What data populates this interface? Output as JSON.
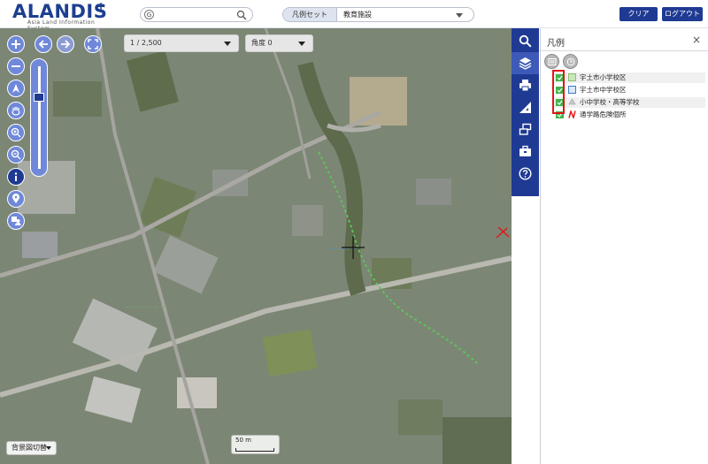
{
  "app": {
    "logo_title": "ALANDIS",
    "logo_plus": "+",
    "logo_subtitle": "Asia Land Information System"
  },
  "header": {
    "search": {
      "prefix": "G",
      "value": ""
    },
    "legend_set": {
      "label": "凡例セット",
      "value": "教育施設"
    },
    "clear_label": "クリア",
    "logout_label": "ログアウト"
  },
  "map": {
    "scale_select": "1 / 2,500",
    "angle_select": "角度 0",
    "basemap_button": "背景図切替",
    "scalebar_label": "50 m"
  },
  "toolbar": {
    "tools": [
      "search-icon",
      "layers-icon",
      "print-icon",
      "measure-icon",
      "window-icon",
      "toolbox-icon",
      "help-icon"
    ]
  },
  "legend_panel": {
    "title": "凡例",
    "close": "×",
    "layers": [
      {
        "label": "宇土市小学校区",
        "checked": true,
        "swatch": "#9ccf88",
        "icon": "green-square-icon"
      },
      {
        "label": "宇土市中学校区",
        "checked": true,
        "swatch": "#6aa6e0",
        "icon": "blue-square-icon"
      },
      {
        "label": "小中学校・高等学校",
        "checked": true,
        "swatch": "#b9b9b9",
        "icon": "school-icon"
      },
      {
        "label": "通学路危険個所",
        "checked": true,
        "swatch": "#e01818",
        "icon": "red-n-icon"
      }
    ]
  },
  "colors": {
    "primary": "#1f3a93",
    "control": "#6f88d9",
    "highlight": "#e01818"
  }
}
